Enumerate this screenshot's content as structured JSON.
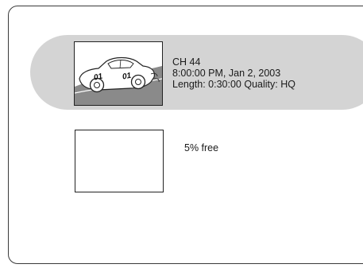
{
  "recording": {
    "channel": "CH 44",
    "datetime": "8:00:00 PM, Jan 2, 2003",
    "details": "Length: 0:30:00 Quality: HQ",
    "thumbnail": {
      "icon": "race-car-icon",
      "car_number": "01"
    }
  },
  "storage": {
    "free_text": "5% free",
    "free_percent": 5
  },
  "colors": {
    "highlight": "#d4d4d4",
    "road": "#8a8a8a"
  }
}
